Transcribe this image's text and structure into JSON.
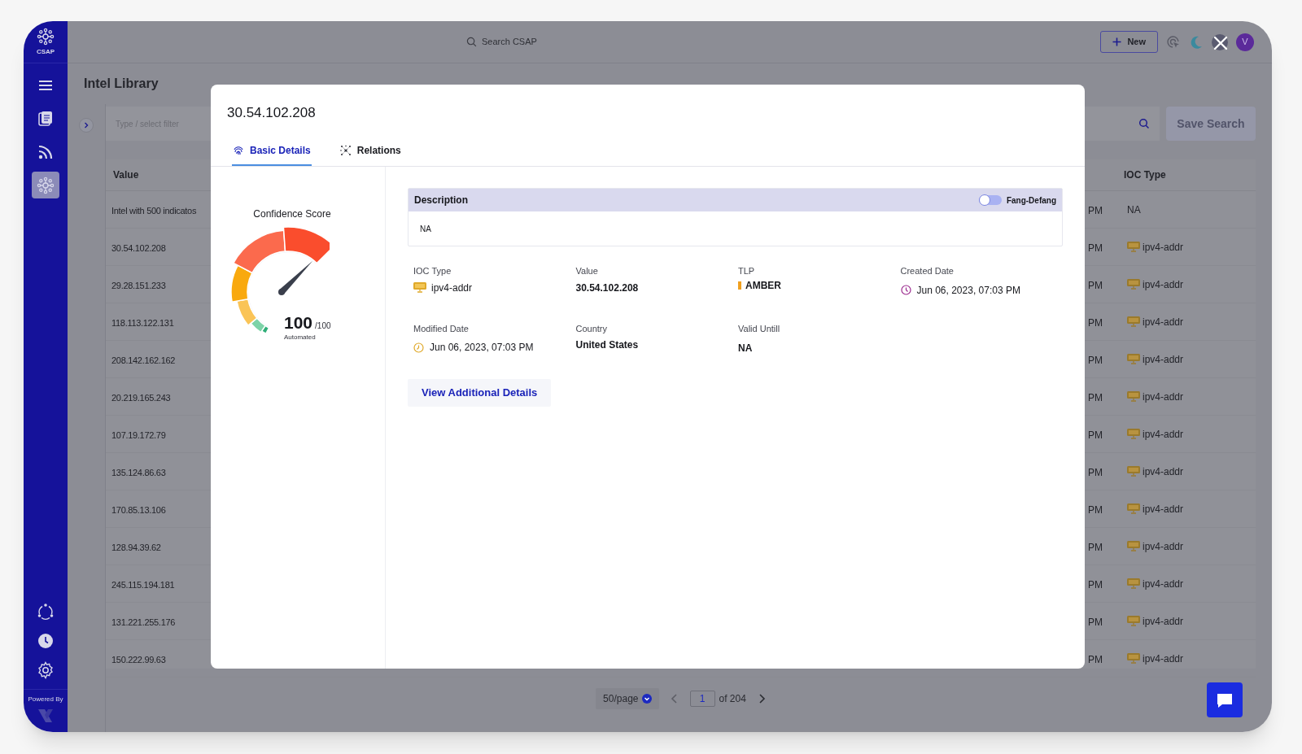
{
  "app": {
    "logo_text": "CSAP",
    "search_placeholder": "Search CSAP",
    "new_button": "New",
    "avatar": "V",
    "page_title": "Intel Library",
    "filter_placeholder": "Type / select filter",
    "save_search": "Save Search",
    "powered_by": "Powered By"
  },
  "sidebar": {
    "items": [
      {
        "kind": "menu",
        "selected": false
      },
      {
        "kind": "document",
        "selected": false
      },
      {
        "kind": "feed",
        "selected": false
      },
      {
        "kind": "network",
        "selected": true
      }
    ],
    "bottom_items": [
      {
        "kind": "cycle"
      },
      {
        "kind": "clock"
      },
      {
        "kind": "settings"
      }
    ]
  },
  "table": {
    "columns": [
      "Value",
      "IOC Type"
    ],
    "rows": [
      {
        "value": "Intel with 500 indicatos",
        "column_time": "PM",
        "ioc_type": "NA",
        "ioc_icon": false
      },
      {
        "value": "30.54.102.208",
        "column_time": "PM",
        "ioc_type": "ipv4-addr",
        "ioc_icon": true
      },
      {
        "value": "29.28.151.233",
        "column_time": "PM",
        "ioc_type": "ipv4-addr",
        "ioc_icon": true
      },
      {
        "value": "118.113.122.131",
        "column_time": "PM",
        "ioc_type": "ipv4-addr",
        "ioc_icon": true
      },
      {
        "value": "208.142.162.162",
        "column_time": "PM",
        "ioc_type": "ipv4-addr",
        "ioc_icon": true
      },
      {
        "value": "20.219.165.243",
        "column_time": "PM",
        "ioc_type": "ipv4-addr",
        "ioc_icon": true
      },
      {
        "value": "107.19.172.79",
        "column_time": "PM",
        "ioc_type": "ipv4-addr",
        "ioc_icon": true
      },
      {
        "value": "135.124.86.63",
        "column_time": "PM",
        "ioc_type": "ipv4-addr",
        "ioc_icon": true
      },
      {
        "value": "170.85.13.106",
        "column_time": "PM",
        "ioc_type": "ipv4-addr",
        "ioc_icon": true
      },
      {
        "value": "128.94.39.62",
        "column_time": "PM",
        "ioc_type": "ipv4-addr",
        "ioc_icon": true
      },
      {
        "value": "245.115.194.181",
        "column_time": "PM",
        "ioc_type": "ipv4-addr",
        "ioc_icon": true
      },
      {
        "value": "131.221.255.176",
        "column_time": "PM",
        "ioc_type": "ipv4-addr",
        "ioc_icon": true
      },
      {
        "value": "150.222.99.63",
        "column_time": "PM",
        "ioc_type": "ipv4-addr",
        "ioc_icon": true
      }
    ]
  },
  "pagination": {
    "page_size": "50/page",
    "page": "1",
    "total": "of 204"
  },
  "modal": {
    "title": "30.54.102.208",
    "tabs": [
      {
        "label": "Basic Details",
        "kind": "fingerprint",
        "selected": true
      },
      {
        "label": "Relations",
        "kind": "relations",
        "selected": false
      }
    ],
    "confidence": {
      "title": "Confidence Score",
      "score": "100",
      "max": "/100",
      "method": "Automated",
      "level": 1.0
    },
    "description": {
      "title": "Description",
      "toggle_label": "Fang-Defang",
      "toggle_on": false,
      "text": "NA"
    },
    "fields": [
      {
        "label": "IOC Type",
        "value": "ipv4-addr",
        "kind": "ioc"
      },
      {
        "label": "Value",
        "value": "30.54.102.208",
        "kind": "plain"
      },
      {
        "label": "TLP",
        "value": "AMBER",
        "kind": "tlp",
        "color": "#f0a020"
      },
      {
        "label": "Created Date",
        "value": "Jun 06, 2023, 07:03 PM",
        "kind": "created"
      },
      {
        "label": "Modified Date",
        "value": "Jun 06, 2023, 07:03 PM",
        "kind": "modified"
      },
      {
        "label": "Country",
        "value": "United States",
        "kind": "plain"
      },
      {
        "label": "Valid Untill",
        "value": "NA",
        "kind": "plain"
      }
    ],
    "action_button": "View Additional Details"
  }
}
